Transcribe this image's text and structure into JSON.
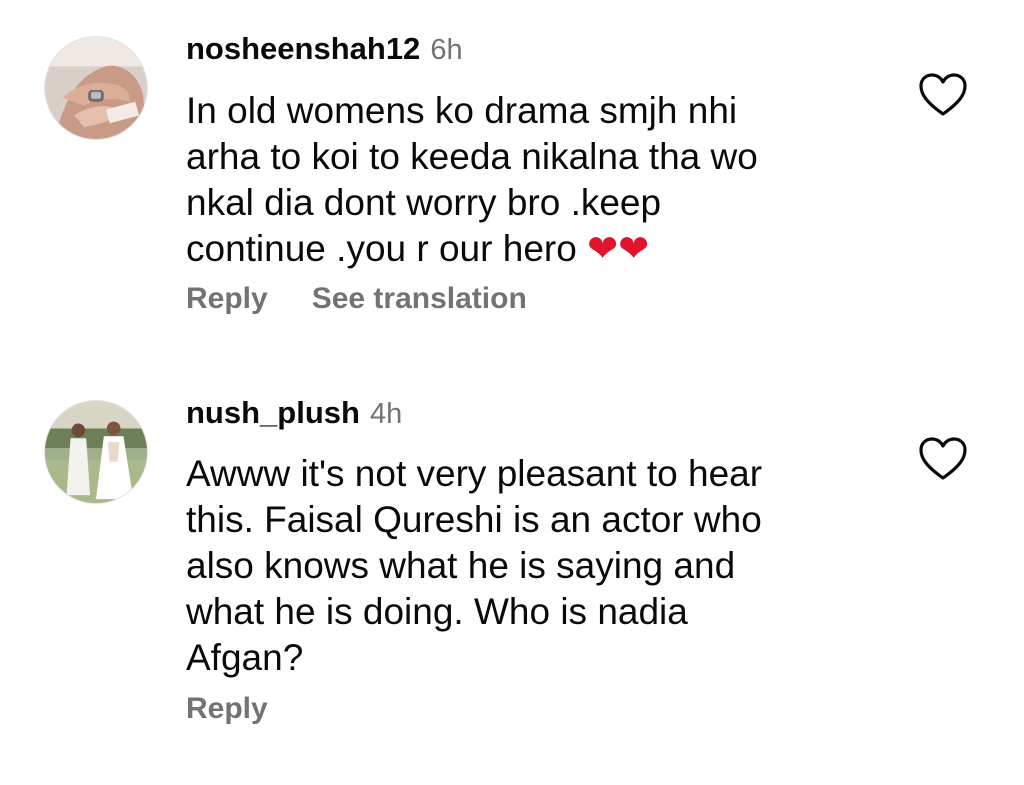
{
  "comments": [
    {
      "username": "nosheenshah12",
      "time": "6h",
      "lines": [
        "In old womens ko drama smjh nhi",
        "arha to koi to keeda nikalna tha wo",
        "nkal dia dont worry bro .keep",
        "continue .you r our hero"
      ],
      "hearts": "❤❤",
      "reply_label": "Reply",
      "translate_label": "See translation",
      "avatar_icon": "avatar-hands-ring",
      "like_icon": "heart-outline-icon"
    },
    {
      "username": "nush_plush",
      "time": "4h",
      "lines": [
        "Awww it's not very pleasant to hear",
        "this. Faisal Qureshi is an actor who",
        "also knows what he is saying and",
        "what he is doing. Who is nadia",
        "Afgan?"
      ],
      "reply_label": "Reply",
      "avatar_icon": "avatar-two-people-field",
      "like_icon": "heart-outline-icon"
    }
  ],
  "colors": {
    "text": "#0a0a0a",
    "secondary": "#737373",
    "heart_emoji": "#e0142c"
  }
}
